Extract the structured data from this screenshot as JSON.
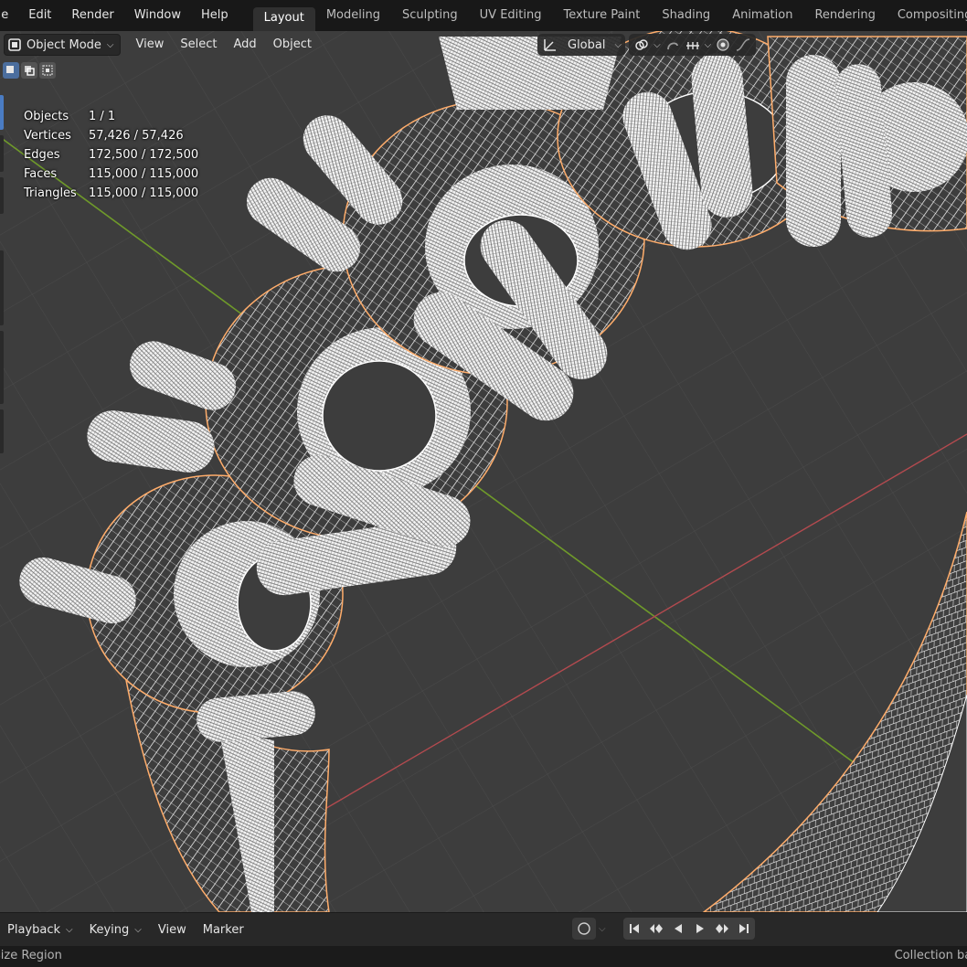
{
  "menubar": {
    "items": [
      "ile",
      "Edit",
      "Render",
      "Window",
      "Help"
    ],
    "tabs": [
      "Layout",
      "Modeling",
      "Sculpting",
      "UV Editing",
      "Texture Paint",
      "Shading",
      "Animation",
      "Rendering",
      "Compositing"
    ],
    "active_tab": "Layout"
  },
  "viewport_header": {
    "mode": "Object Mode",
    "menus": [
      "View",
      "Select",
      "Add",
      "Object"
    ],
    "transform_orientation": "Global"
  },
  "stats": {
    "rows": [
      {
        "label": "Objects",
        "value": "1 / 1"
      },
      {
        "label": "Vertices",
        "value": "57,426 / 57,426"
      },
      {
        "label": "Edges",
        "value": "172,500 / 172,500"
      },
      {
        "label": "Faces",
        "value": "115,000 / 115,000"
      },
      {
        "label": "Triangles",
        "value": "115,000 / 115,000"
      }
    ]
  },
  "timeline": {
    "playback": "Playback",
    "keying": "Keying",
    "view": "View",
    "marker": "Marker"
  },
  "statusbar": {
    "left": "size Region",
    "right": "Collection bas"
  },
  "colors": {
    "viewport_bg": "#3d3d3d",
    "grid_line": "#4a4a4a",
    "x_axis": "#b34a4f",
    "y_axis": "#6f9a2a",
    "wire": "#ffffff",
    "selection_outline": "#ffad6b",
    "accent": "#4a7cc3"
  },
  "icons": [
    "object-mode-icon",
    "chevron-down-icon",
    "transform-orientation-icon",
    "link-icon",
    "snap-icon",
    "snap-increment-icon",
    "proportional-edit-icon",
    "falloff-icon",
    "record-icon",
    "jump-start-icon",
    "prev-keyframe-icon",
    "play-reverse-icon",
    "play-icon",
    "next-keyframe-icon",
    "jump-end-icon"
  ]
}
